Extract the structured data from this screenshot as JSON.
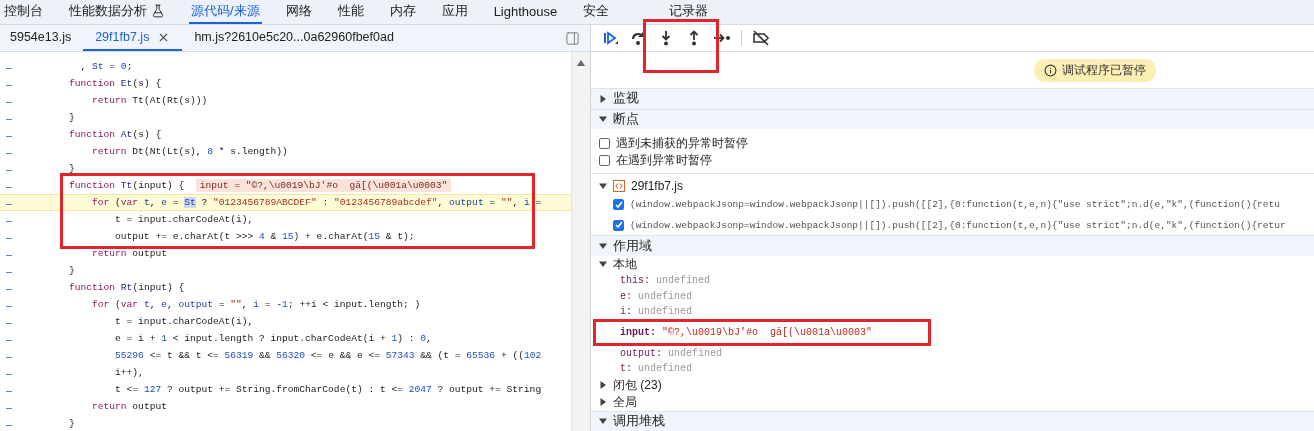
{
  "main_tabs": [
    {
      "label": "控制台",
      "selected": false,
      "icon": false
    },
    {
      "label": "性能数据分析",
      "selected": false,
      "icon": true
    },
    {
      "label": "源代码/来源",
      "selected": true,
      "icon": false
    },
    {
      "label": "网络",
      "selected": false,
      "icon": false
    },
    {
      "label": "性能",
      "selected": false,
      "icon": false
    },
    {
      "label": "内存",
      "selected": false,
      "icon": false
    },
    {
      "label": "应用",
      "selected": false,
      "icon": false
    },
    {
      "label": "Lighthouse",
      "selected": false,
      "icon": false
    },
    {
      "label": "安全",
      "selected": false,
      "icon": false
    },
    {
      "label": "记录器",
      "selected": false,
      "icon": false
    }
  ],
  "file_tabs": [
    {
      "label": "5954e13.js",
      "selected": false,
      "closable": false
    },
    {
      "label": "29f1fb7.js",
      "selected": true,
      "closable": true
    },
    {
      "label": "hm.js?2610e5c20...0a62960fbef0ad",
      "selected": false,
      "closable": false
    }
  ],
  "code": {
    "lines": [
      {
        "marker": "–",
        "paused": false,
        "boxed": false,
        "segments": [
          {
            "kind": "plain",
            "text": "      , "
          },
          {
            "kind": "var",
            "text": "St"
          },
          {
            "kind": "plain",
            "text": " = "
          },
          {
            "kind": "num",
            "text": "0"
          },
          {
            "kind": "plain",
            "text": ";"
          }
        ]
      },
      {
        "marker": "–",
        "paused": false,
        "boxed": false,
        "segments": [
          {
            "kind": "kw",
            "text": "    function"
          },
          {
            "kind": "def",
            "text": " Et"
          },
          {
            "kind": "plain",
            "text": "(s) {"
          }
        ]
      },
      {
        "marker": "–",
        "paused": false,
        "boxed": false,
        "segments": [
          {
            "kind": "kw",
            "text": "        return"
          },
          {
            "kind": "plain",
            "text": " Tt(At(Rt(s)))"
          }
        ]
      },
      {
        "marker": "–",
        "paused": false,
        "boxed": false,
        "segments": [
          {
            "kind": "plain",
            "text": "    }"
          }
        ]
      },
      {
        "marker": "–",
        "paused": false,
        "boxed": false,
        "segments": [
          {
            "kind": "kw",
            "text": "    function"
          },
          {
            "kind": "def",
            "text": " At"
          },
          {
            "kind": "plain",
            "text": "(s) {"
          }
        ]
      },
      {
        "marker": "–",
        "paused": false,
        "boxed": false,
        "segments": [
          {
            "kind": "kw",
            "text": "        return"
          },
          {
            "kind": "plain",
            "text": " Dt(Nt(Lt(s), "
          },
          {
            "kind": "num",
            "text": "8"
          },
          {
            "kind": "plain",
            "text": " * s.length))"
          }
        ]
      },
      {
        "marker": "–",
        "paused": false,
        "boxed": false,
        "segments": [
          {
            "kind": "plain",
            "text": "    }"
          }
        ]
      },
      {
        "marker": "–",
        "paused": false,
        "boxed": true,
        "segments": [
          {
            "kind": "kw",
            "text": "    function"
          },
          {
            "kind": "def",
            "text": " Tt"
          },
          {
            "kind": "plain",
            "text": "(input) {  "
          },
          {
            "kind": "inline",
            "text": "input = \"©?,\\u0019\\bJ'#o  gä[(\\u001a\\u0003\""
          }
        ]
      },
      {
        "marker": "–",
        "paused": true,
        "boxed": true,
        "segments": [
          {
            "kind": "kw",
            "text": "        for"
          },
          {
            "kind": "plain",
            "text": " ("
          },
          {
            "kind": "kw",
            "text": "var"
          },
          {
            "kind": "var",
            "text": " t"
          },
          {
            "kind": "plain",
            "text": ", "
          },
          {
            "kind": "var",
            "text": "e"
          },
          {
            "kind": "plain",
            "text": " = "
          },
          {
            "kind": "sel",
            "text": "St"
          },
          {
            "kind": "plain",
            "text": " ? "
          },
          {
            "kind": "str",
            "text": "\"0123456789ABCDEF\""
          },
          {
            "kind": "plain",
            "text": " : "
          },
          {
            "kind": "str",
            "text": "\"0123456789abcdef\""
          },
          {
            "kind": "plain",
            "text": ", "
          },
          {
            "kind": "var",
            "text": "output"
          },
          {
            "kind": "plain",
            "text": " = "
          },
          {
            "kind": "str",
            "text": "\"\""
          },
          {
            "kind": "plain",
            "text": ", "
          },
          {
            "kind": "var",
            "text": "i"
          },
          {
            "kind": "plain",
            "text": " ="
          }
        ]
      },
      {
        "marker": "–",
        "paused": false,
        "boxed": true,
        "segments": [
          {
            "kind": "plain",
            "text": "            t = input.charCodeAt(i),"
          }
        ]
      },
      {
        "marker": "–",
        "paused": false,
        "boxed": true,
        "segments": [
          {
            "kind": "plain",
            "text": "            output += e.charAt(t >>> "
          },
          {
            "kind": "num",
            "text": "4"
          },
          {
            "kind": "plain",
            "text": " & "
          },
          {
            "kind": "num",
            "text": "15"
          },
          {
            "kind": "plain",
            "text": ") + e.charAt("
          },
          {
            "kind": "num",
            "text": "15"
          },
          {
            "kind": "plain",
            "text": " & t);"
          }
        ]
      },
      {
        "marker": "–",
        "paused": false,
        "boxed": false,
        "segments": [
          {
            "kind": "kw",
            "text": "        return"
          },
          {
            "kind": "plain",
            "text": " output"
          }
        ]
      },
      {
        "marker": "–",
        "paused": false,
        "boxed": false,
        "segments": [
          {
            "kind": "plain",
            "text": "    }"
          }
        ]
      },
      {
        "marker": "–",
        "paused": false,
        "boxed": false,
        "segments": [
          {
            "kind": "kw",
            "text": "    function"
          },
          {
            "kind": "def",
            "text": " Rt"
          },
          {
            "kind": "plain",
            "text": "(input) {"
          }
        ]
      },
      {
        "marker": "–",
        "paused": false,
        "boxed": false,
        "segments": [
          {
            "kind": "kw",
            "text": "        for"
          },
          {
            "kind": "plain",
            "text": " ("
          },
          {
            "kind": "kw",
            "text": "var"
          },
          {
            "kind": "var",
            "text": " t"
          },
          {
            "kind": "plain",
            "text": ", "
          },
          {
            "kind": "var",
            "text": "e"
          },
          {
            "kind": "plain",
            "text": ", "
          },
          {
            "kind": "var",
            "text": "output"
          },
          {
            "kind": "plain",
            "text": " = "
          },
          {
            "kind": "str",
            "text": "\"\""
          },
          {
            "kind": "plain",
            "text": ", "
          },
          {
            "kind": "var",
            "text": "i"
          },
          {
            "kind": "plain",
            "text": " = -"
          },
          {
            "kind": "num",
            "text": "1"
          },
          {
            "kind": "plain",
            "text": "; ++i < input.length; )"
          }
        ]
      },
      {
        "marker": "–",
        "paused": false,
        "boxed": false,
        "segments": [
          {
            "kind": "plain",
            "text": "            t = input.charCodeAt(i),"
          }
        ]
      },
      {
        "marker": "–",
        "paused": false,
        "boxed": false,
        "segments": [
          {
            "kind": "plain",
            "text": "            e = i + "
          },
          {
            "kind": "num",
            "text": "1"
          },
          {
            "kind": "plain",
            "text": " < input.length ? input.charCodeAt(i + "
          },
          {
            "kind": "num",
            "text": "1"
          },
          {
            "kind": "plain",
            "text": ") : "
          },
          {
            "kind": "num",
            "text": "0"
          },
          {
            "kind": "plain",
            "text": ","
          }
        ]
      },
      {
        "marker": "–",
        "paused": false,
        "boxed": false,
        "segments": [
          {
            "kind": "num",
            "text": "            55296"
          },
          {
            "kind": "plain",
            "text": " <= t && t <= "
          },
          {
            "kind": "num",
            "text": "56319"
          },
          {
            "kind": "plain",
            "text": " && "
          },
          {
            "kind": "num",
            "text": "56320"
          },
          {
            "kind": "plain",
            "text": " <= e && e <= "
          },
          {
            "kind": "num",
            "text": "57343"
          },
          {
            "kind": "plain",
            "text": " && (t = "
          },
          {
            "kind": "num",
            "text": "65536"
          },
          {
            "kind": "plain",
            "text": " + (("
          },
          {
            "kind": "num",
            "text": "102"
          }
        ]
      },
      {
        "marker": "–",
        "paused": false,
        "boxed": false,
        "segments": [
          {
            "kind": "plain",
            "text": "            i++),"
          }
        ]
      },
      {
        "marker": "–",
        "paused": false,
        "boxed": false,
        "segments": [
          {
            "kind": "plain",
            "text": "            t <= "
          },
          {
            "kind": "num",
            "text": "127"
          },
          {
            "kind": "plain",
            "text": " ? output += String.fromCharCode(t) : t <= "
          },
          {
            "kind": "num",
            "text": "2047"
          },
          {
            "kind": "plain",
            "text": " ? output += String"
          }
        ]
      },
      {
        "marker": "–",
        "paused": false,
        "boxed": false,
        "segments": [
          {
            "kind": "kw",
            "text": "        return"
          },
          {
            "kind": "plain",
            "text": " output"
          }
        ]
      },
      {
        "marker": "–",
        "paused": false,
        "boxed": false,
        "segments": [
          {
            "kind": "plain",
            "text": "    }"
          }
        ]
      }
    ]
  },
  "debug_toolbar": {
    "buttons": [
      {
        "kind": "resume",
        "boxed": false
      },
      {
        "kind": "step_over",
        "boxed": false
      },
      {
        "kind": "step_into",
        "boxed": true
      },
      {
        "kind": "step_out",
        "boxed": true
      },
      {
        "kind": "step",
        "boxed": false
      },
      {
        "kind": "deactivate",
        "boxed": false
      }
    ]
  },
  "status_badge": {
    "text": "调试程序已暂停"
  },
  "watch": {
    "title": "监视",
    "expanded": false
  },
  "breakpoints": {
    "title": "断点",
    "expanded": true,
    "options": [
      {
        "label": "遇到未捕获的异常时暂停",
        "checked": false
      },
      {
        "label": "在遇到异常时暂停",
        "checked": false
      }
    ],
    "files": [
      {
        "name": "29f1fb7.js",
        "expanded": true,
        "items": [
          {
            "code": "(window.webpackJsonp=window.webpackJsonp||[]).push([[2],{0:function(t,e,n){\"use strict\";n.d(e,\"k\",(function(){retu",
            "checked": true
          },
          {
            "code": "(window.webpackJsonp=window.webpackJsonp||[]).push([[2],{0:function(t,e,n){\"use strict\";n.d(e,\"k\",(function(){retur",
            "checked": true
          }
        ]
      }
    ]
  },
  "scope": {
    "title": "作用域",
    "expanded": true,
    "groups": [
      {
        "label": "本地",
        "expanded": true,
        "variables": [
          {
            "name": "this:",
            "value": "undefined",
            "kind": "undefined",
            "boxed": false
          },
          {
            "name": "e:",
            "value": "undefined",
            "kind": "undefined",
            "boxed": false
          },
          {
            "name": "i:",
            "value": "undefined",
            "kind": "undefined",
            "boxed": false
          },
          {
            "name": "input:",
            "value": "\"©?,\\u0019\\bJ'#o  gä[(\\u001a\\u0003\"",
            "kind": "string",
            "boxed": true
          },
          {
            "name": "output:",
            "value": "undefined",
            "kind": "undefined",
            "boxed": false
          },
          {
            "name": "t:",
            "value": "undefined",
            "kind": "undefined",
            "boxed": false
          }
        ]
      },
      {
        "label": "闭包 (23)",
        "expanded": false
      },
      {
        "label": "全局",
        "expanded": false
      }
    ]
  },
  "call_stack": {
    "title": "调用堆栈",
    "expanded": true
  }
}
